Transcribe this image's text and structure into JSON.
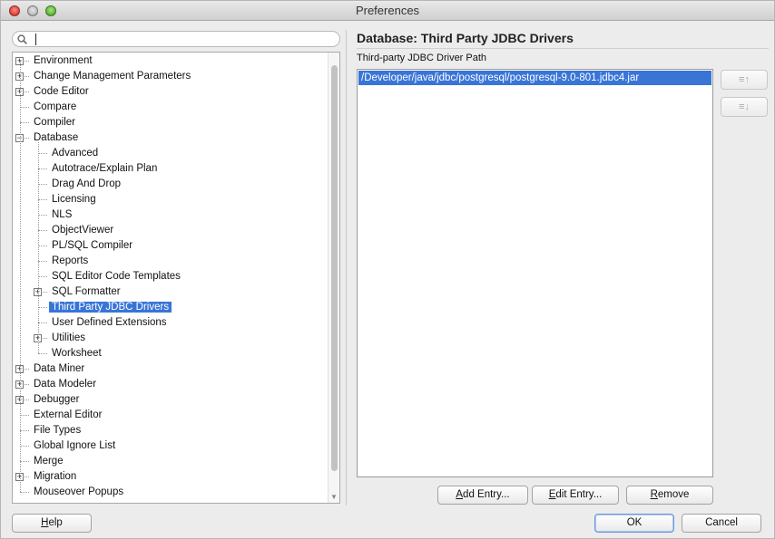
{
  "window": {
    "title": "Preferences"
  },
  "search": {
    "value": "",
    "placeholder": ""
  },
  "tree": {
    "items": [
      {
        "label": "Environment",
        "depth": 0,
        "expandable": true,
        "expanded": false
      },
      {
        "label": "Change Management Parameters",
        "depth": 0,
        "expandable": true,
        "expanded": false
      },
      {
        "label": "Code Editor",
        "depth": 0,
        "expandable": true,
        "expanded": false
      },
      {
        "label": "Compare",
        "depth": 0,
        "expandable": false
      },
      {
        "label": "Compiler",
        "depth": 0,
        "expandable": false
      },
      {
        "label": "Database",
        "depth": 0,
        "expandable": true,
        "expanded": true
      },
      {
        "label": "Advanced",
        "depth": 1,
        "expandable": false
      },
      {
        "label": "Autotrace/Explain Plan",
        "depth": 1,
        "expandable": false
      },
      {
        "label": "Drag And Drop",
        "depth": 1,
        "expandable": false
      },
      {
        "label": "Licensing",
        "depth": 1,
        "expandable": false
      },
      {
        "label": "NLS",
        "depth": 1,
        "expandable": false
      },
      {
        "label": "ObjectViewer",
        "depth": 1,
        "expandable": false
      },
      {
        "label": "PL/SQL Compiler",
        "depth": 1,
        "expandable": false
      },
      {
        "label": "Reports",
        "depth": 1,
        "expandable": false
      },
      {
        "label": "SQL Editor Code Templates",
        "depth": 1,
        "expandable": false
      },
      {
        "label": "SQL Formatter",
        "depth": 1,
        "expandable": true,
        "expanded": false
      },
      {
        "label": "Third Party JDBC Drivers",
        "depth": 1,
        "expandable": false,
        "selected": true
      },
      {
        "label": "User Defined Extensions",
        "depth": 1,
        "expandable": false
      },
      {
        "label": "Utilities",
        "depth": 1,
        "expandable": true,
        "expanded": false
      },
      {
        "label": "Worksheet",
        "depth": 1,
        "expandable": false
      },
      {
        "label": "Data Miner",
        "depth": 0,
        "expandable": true,
        "expanded": false
      },
      {
        "label": "Data Modeler",
        "depth": 0,
        "expandable": true,
        "expanded": false
      },
      {
        "label": "Debugger",
        "depth": 0,
        "expandable": true,
        "expanded": false
      },
      {
        "label": "External Editor",
        "depth": 0,
        "expandable": false
      },
      {
        "label": "File Types",
        "depth": 0,
        "expandable": false
      },
      {
        "label": "Global Ignore List",
        "depth": 0,
        "expandable": false
      },
      {
        "label": "Merge",
        "depth": 0,
        "expandable": false
      },
      {
        "label": "Migration",
        "depth": 0,
        "expandable": true,
        "expanded": false
      },
      {
        "label": "Mouseover Popups",
        "depth": 0,
        "expandable": false
      }
    ]
  },
  "panel": {
    "title": "Database: Third Party JDBC Drivers",
    "path_label": "Third-party JDBC Driver Path",
    "entries": [
      "/Developer/java/jdbc/postgresql/postgresql-9.0-801.jdbc4.jar"
    ],
    "move_up_label": "≡↑",
    "move_down_label": "≡↓",
    "add_label": "Add Entry...",
    "edit_label": "Edit Entry...",
    "remove_label": "Remove"
  },
  "footer": {
    "help_label": "Help",
    "ok_label": "OK",
    "cancel_label": "Cancel"
  },
  "colors": {
    "selection": "#3875d7",
    "window_bg": "#ececec"
  }
}
